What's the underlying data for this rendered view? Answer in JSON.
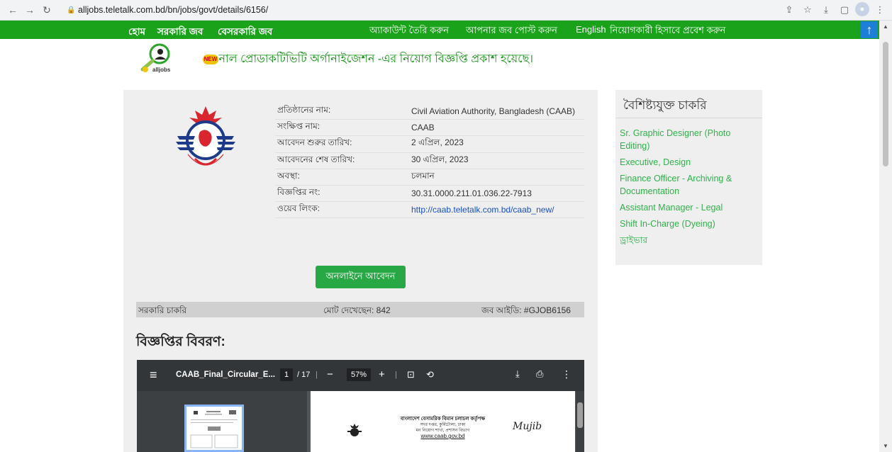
{
  "browser": {
    "url": "alljobs.teletalk.com.bd/bn/jobs/govt/details/6156/"
  },
  "nav": {
    "home": "হোম",
    "govt_jobs": "সরকারি জব",
    "private_jobs": "বেসরকারি জব",
    "create_account": "অ্যাকাউন্ট তৈরি করুন",
    "post_job": "আপনার জব পোস্ট করুন",
    "english": "English",
    "employer_login": "নিয়োগকারী হিসাবে প্রবেশ করুন",
    "scroll_top_icon": "arrow-up-icon"
  },
  "logo": {
    "text": "alljobs"
  },
  "ticker": {
    "badge": "NEW",
    "text": "নাল প্রোডাকটিভিটি অর্গানাইজেশন -এর নিয়োগ বিজ্ঞপ্তি প্রকাশ হয়েছে।"
  },
  "job": {
    "rows": [
      {
        "label": "প্রতিষ্ঠানের নাম:",
        "value": "Civil Aviation Authority, Bangladesh (CAAB)"
      },
      {
        "label": "সংক্ষিপ্ত নাম:",
        "value": "CAAB"
      },
      {
        "label": "আবেদন শুরুর তারিখ:",
        "value": "2 এপ্রিল, 2023"
      },
      {
        "label": "আবেদনের শেষ তারিখ:",
        "value": "30 এপ্রিল, 2023"
      },
      {
        "label": "অবস্থা:",
        "value": "চলমান"
      },
      {
        "label": "বিজ্ঞপ্তির নং:",
        "value": "30.31.0000.211.01.036.22-7913"
      },
      {
        "label": "ওয়েব লিংক:",
        "value": "http://caab.teletalk.com.bd/caab_new/"
      }
    ],
    "apply_button": "অনলাইনে আবেদন",
    "category": "সরকারি চাকরি",
    "views": "মোট দেখেছেন: 842",
    "job_id": "জব আইডি: #GJOB6156",
    "details_title": "বিজ্ঞপ্তির বিবরণ:"
  },
  "pdf": {
    "filename": "CAAB_Final_Circular_E...",
    "page_current": "1",
    "page_total": "/ 17",
    "zoom": "57%",
    "header_line1": "বাংলাদেশ বেসামরিক বিমান চলাচল কর্তৃপক্ষ",
    "header_line2": "সদর দপ্তর, কুর্মিটোলা, ঢাকা",
    "header_line3": "মন নিয়োগ শাখা, প্রশাসন বিভাগ",
    "header_site": "www.caab.gov.bd",
    "mujib_text": "Mujib"
  },
  "sidebar": {
    "title": "বৈশিষ্ট্যযুক্ত চাকরি",
    "items": [
      "Sr. Graphic Designer (Photo Editing)",
      "Executive, Design",
      "Finance Officer - Archiving & Documentation",
      "Assistant Manager - Legal",
      "Shift In-Charge (Dyeing)",
      "ড্রাইভার"
    ]
  },
  "colors": {
    "nav_green": "#1aa31a",
    "apply_green": "#28a745",
    "link_blue": "#1a4fc7",
    "sidebar_link": "#2fb34a"
  }
}
